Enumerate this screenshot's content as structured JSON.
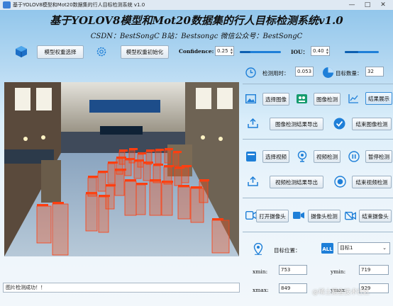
{
  "window": {
    "title": "基于YOLOV8模型和Mot20数据集的行人目标检测系统 v1.0"
  },
  "header": {
    "title": "基于YOLOV8模型和Mot20数据集的行人目标检测系统v1.0",
    "subtitle": "CSDN：BestSongC   B站：Bestsongc   微信公众号：BestSongC"
  },
  "toolbar": {
    "weights_select_label": "模型权重选择",
    "weights_init_label": "模型权重初始化",
    "confidence_label": "Confidence:",
    "confidence_value": "0.25",
    "iou_label": "IOU：",
    "iou_value": "0.40",
    "confidence_level": 0.25,
    "iou_level": 0.4
  },
  "stats": {
    "time_label": "检测用时：",
    "time_value": "0.053",
    "count_label": "目标数量：",
    "count_value": "32"
  },
  "image_panel": {
    "select_image_label": "选择图像",
    "detect_image_label": "图像检测",
    "show_result_label": "结果展示",
    "export_image_label": "图像检测结果导出",
    "end_image_label": "结束图像检测"
  },
  "video_panel": {
    "select_video_label": "选择视频",
    "detect_video_label": "视频检测",
    "pause_label": "暂停检测",
    "export_video_label": "视频检测结果导出",
    "end_video_label": "结束视频检测"
  },
  "camera_panel": {
    "open_camera_label": "打开摄像头",
    "camera_detect_label": "摄像头检测",
    "close_camera_label": "结束摄像头"
  },
  "target_panel": {
    "position_label": "目标位置：",
    "target_select_value": "目标1",
    "xmin_label": "xmin:",
    "xmin_value": "753",
    "ymin_label": "ymin:",
    "ymin_value": "719",
    "xmax_label": "xmax:",
    "xmax_value": "849",
    "ymax_label": "ymax:",
    "ymax_value": "929"
  },
  "status_bar": {
    "text": "图片检测成功！！"
  },
  "watermark": "@稀土掘金技术社区",
  "detection_tag": "human",
  "colors": {
    "accent": "#1e7fd8",
    "detection": "#ff3e10"
  }
}
